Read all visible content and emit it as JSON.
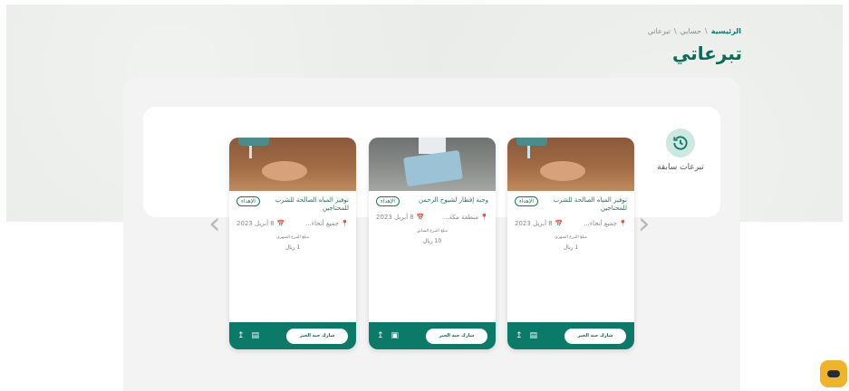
{
  "breadcrumb": {
    "home": "الرئيسية",
    "sep": "\\",
    "account": "حسابي",
    "current": "تبرعاتي"
  },
  "page_title": "تبرعاتي",
  "past_section_label": "تبرعات سابقة",
  "cards": [
    {
      "title": "توفير المياه الصالحة للشرب للمحتاجين",
      "badge": "الإهداء",
      "location": "جميع أنحاء...",
      "date": "8 أبريل 2023",
      "sub_label": "مبلغ التبرع الشهري",
      "sub_value": "1 ريال",
      "share_button": "شارك حبة الخير"
    },
    {
      "title": "وجبة إفطار لشيوخ الرحمن",
      "badge": "الإهداء",
      "location": "منطقة مكة...",
      "date": "8 أبريل 2023",
      "sub_label": "مبلغ التبرع السابق",
      "sub_value": "10 ريال",
      "share_button": "شارك حبة الخير"
    },
    {
      "title": "توفير المياه الصالحة للشرب للمحتاجين",
      "badge": "الإهداء",
      "location": "جميع أنحاء...",
      "date": "8 أبريل 2023",
      "sub_label": "مبلغ التبرع الشهري",
      "sub_value": "1 ريال",
      "share_button": "شارك حبة الخير"
    }
  ],
  "colors": {
    "brand": "#0b7a68",
    "chat": "#f0b429"
  }
}
